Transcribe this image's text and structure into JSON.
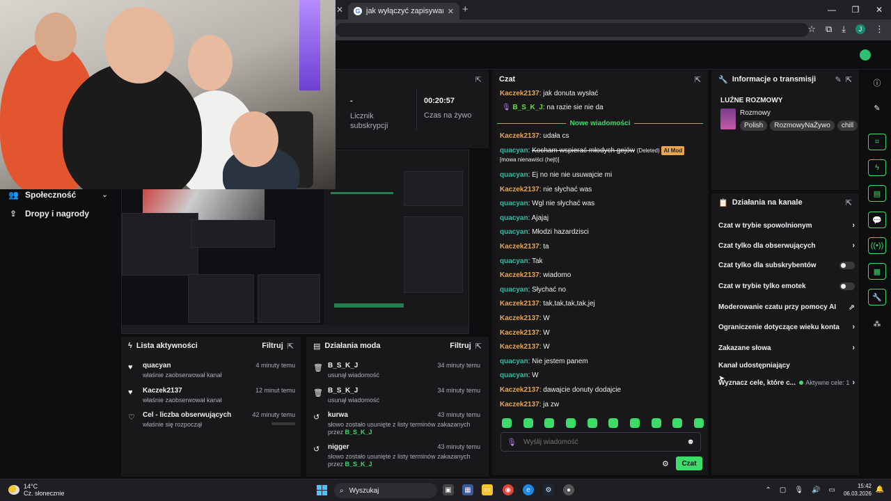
{
  "browser": {
    "tab_title": "jak wyłączyć zapisywanie trans",
    "tab_close": "✕",
    "new_tab": "+",
    "win_min": "—",
    "win_max": "❐",
    "win_close": "✕",
    "profile_initial": "J"
  },
  "left_nav": {
    "items": [
      {
        "label": "Społeczność",
        "icon": "community-icon"
      },
      {
        "label": "Dropy i nagrody",
        "icon": "drops-icon"
      }
    ]
  },
  "stream_stats": {
    "subs_value": "-",
    "subs_label": "Licznik subskrypcji",
    "live_value": "00:20:57",
    "live_label": "Czas na żywo"
  },
  "chat": {
    "title": "Czat",
    "new_messages_label": "Nowe wiadomości",
    "messages_before": [
      {
        "user": "Kaczek2137",
        "text": ": jak donuta wysłać",
        "color": "u1"
      },
      {
        "user": "B_S_K_J",
        "text": ": na razie sie nie da",
        "color": "u3",
        "mic": true
      }
    ],
    "messages_after": [
      {
        "user": "Kaczek2137",
        "text": ": udała cs",
        "color": "u1"
      },
      {
        "user": "quacyan",
        "text": ": Ej no nie nie usuwajcie mi",
        "color": "u2"
      },
      {
        "user": "Kaczek2137",
        "text": ": nie słychać was",
        "color": "u1"
      },
      {
        "user": "quacyan",
        "text": ": Wgl nie słychać was",
        "color": "u2"
      },
      {
        "user": "quacyan",
        "text": ": Ajajaj",
        "color": "u2"
      },
      {
        "user": "quacyan",
        "text": ": Młodzi hazardzisci",
        "color": "u2"
      },
      {
        "user": "Kaczek2137",
        "text": ": ta",
        "color": "u1"
      },
      {
        "user": "quacyan",
        "text": ": Tak",
        "color": "u2"
      },
      {
        "user": "Kaczek2137",
        "text": ": wiadomo",
        "color": "u1"
      },
      {
        "user": "quacyan",
        "text": ": Słychać no",
        "color": "u2"
      },
      {
        "user": "Kaczek2137",
        "text": ": tak,tak,tak,tak,jej",
        "color": "u1"
      },
      {
        "user": "Kaczek2137",
        "text": ": W",
        "color": "u1"
      },
      {
        "user": "Kaczek2137",
        "text": ": W",
        "color": "u1"
      },
      {
        "user": "Kaczek2137",
        "text": ": W",
        "color": "u1"
      },
      {
        "user": "quacyan",
        "text": ": Nie jestem panem",
        "color": "u2"
      },
      {
        "user": "quacyan",
        "text": ": W",
        "color": "u2"
      },
      {
        "user": "Kaczek2137",
        "text": ": dawajcie donuty dodajcie",
        "color": "u1"
      },
      {
        "user": "Kaczek2137",
        "text": ": ja zw",
        "color": "u1"
      }
    ],
    "deleted_msg": {
      "user": "quacyan",
      "text": "Kocham wspierać młodych gejów",
      "deleted_tag": "(Deleted)",
      "badge": "AI Mod",
      "reason": "[mowa nienawiści (hejt)]"
    },
    "input_placeholder": "Wyślij wiadomość",
    "send_label": "Czat"
  },
  "info": {
    "title": "Informacje o transmisji",
    "stream_title": "LUŹNE ROZMOWY",
    "category": "Rozmowy",
    "tags": [
      "Polish",
      "RozmowyNaŻywo",
      "chill"
    ]
  },
  "actions": {
    "title": "Działania na kanale",
    "rows": [
      {
        "label": "Czat w trybie spowolnionym",
        "kind": "arrow"
      },
      {
        "label": "Czat tylko dla obserwujących",
        "kind": "arrow"
      },
      {
        "label": "Czat tylko dla subskrybentów",
        "kind": "toggle"
      },
      {
        "label": "Czat w trybie tylko emotek",
        "kind": "toggle"
      },
      {
        "label": "Moderowanie czatu przy pomocy AI",
        "kind": "external"
      },
      {
        "label": "Ograniczenie dotyczące wieku konta",
        "kind": "arrow"
      },
      {
        "label": "Zakazane słowa",
        "kind": "arrow"
      },
      {
        "label": "Kanał udostępniający",
        "kind": "none"
      },
      {
        "label": "Wyznacz cele, które c...",
        "kind": "arrow",
        "sub": "Aktywne cele: 1"
      }
    ]
  },
  "activity": {
    "title": "Lista aktywności",
    "filter": "Filtruj",
    "items": [
      {
        "name": "quacyan",
        "time": "4 minuty temu",
        "desc": "właśnie zaobserwował kanał"
      },
      {
        "name": "Kaczek2137",
        "time": "12 minut temu",
        "desc": "właśnie zaobserwował kanał"
      },
      {
        "name": "Cel - liczba obserwujących",
        "time": "42 minuty temu",
        "desc": "właśnie się rozpoczął"
      }
    ]
  },
  "mods": {
    "title": "Działania moda",
    "filter": "Filtruj",
    "items": [
      {
        "name": "B_S_K_J",
        "time": "34 minuty temu",
        "desc": "usunął wiadomość",
        "by": ""
      },
      {
        "name": "B_S_K_J",
        "time": "34 minuty temu",
        "desc": "usunął wiadomość",
        "by": ""
      },
      {
        "name": "kurwa",
        "time": "43 minuty temu",
        "desc": "słowo zostało usunięte z listy terminów zakazanych przez",
        "by": "B_S_K_J"
      },
      {
        "name": "nigger",
        "time": "43 minuty temu",
        "desc": "słowo zostało usunięte z listy terminów zakazanych przez",
        "by": "B_S_K_J"
      }
    ]
  },
  "taskbar": {
    "temp": "14°C",
    "weather": "Cz. słonecznie",
    "search": "Wyszukaj",
    "time": "15:42",
    "date": "06.03.2026"
  },
  "colors": {
    "accent": "#3ddc6a",
    "user_orange": "#e8a652",
    "user_teal": "#2fbfa1"
  }
}
